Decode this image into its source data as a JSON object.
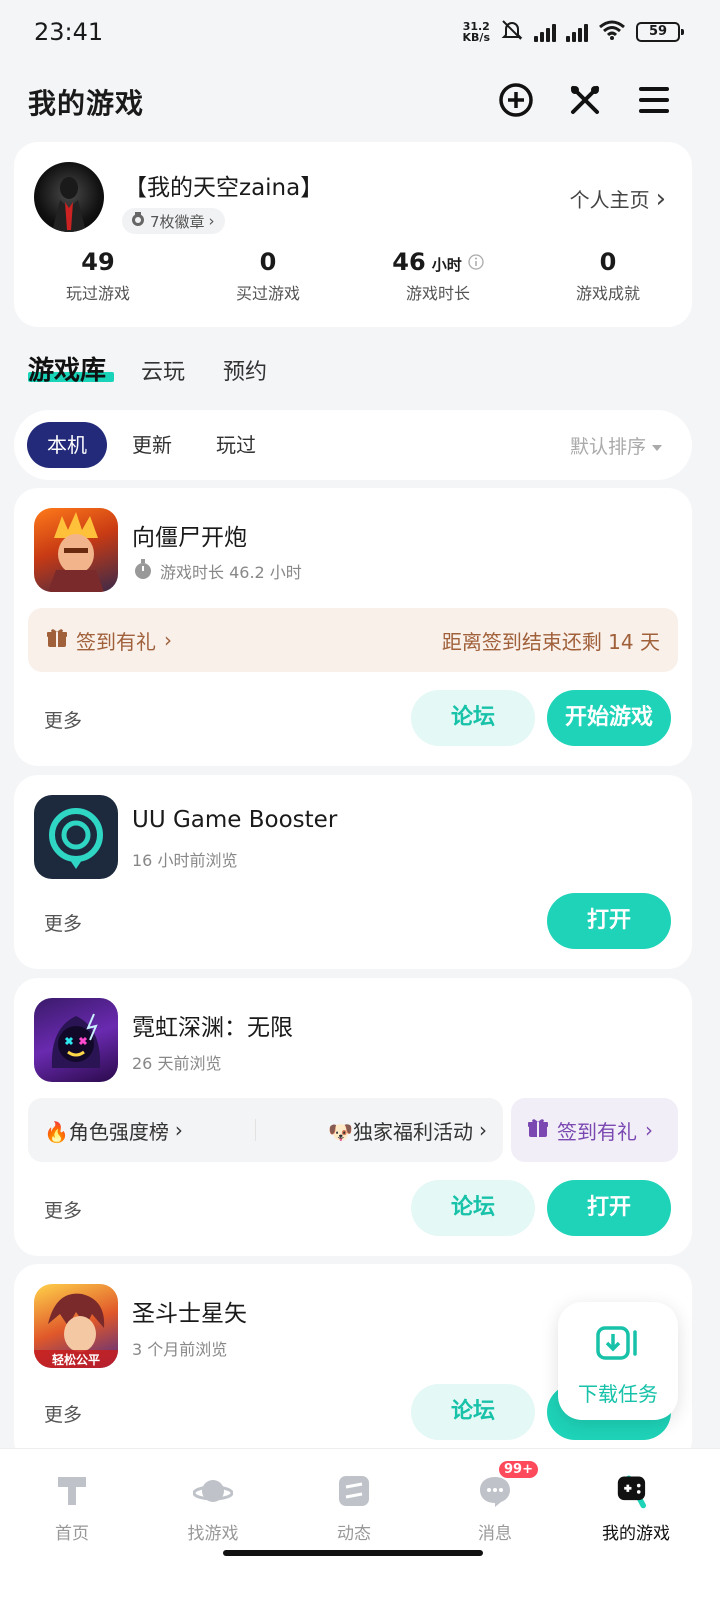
{
  "status_bar": {
    "time": "23:41",
    "net_speed_value": "31.2",
    "net_speed_unit": "KB/s",
    "battery": "59"
  },
  "header": {
    "title": "我的游戏",
    "icons": [
      "add-circle-icon",
      "tools-icon",
      "menu-icon"
    ]
  },
  "profile": {
    "username": "【我的天空zaina】",
    "badge_label": "7枚徽章",
    "profile_link": "个人主页",
    "stats": [
      {
        "value": "49",
        "unit": "",
        "label": "玩过游戏"
      },
      {
        "value": "0",
        "unit": "",
        "label": "买过游戏"
      },
      {
        "value": "46",
        "unit": "小时",
        "label": "游戏时长"
      },
      {
        "value": "0",
        "unit": "",
        "label": "游戏成就"
      }
    ]
  },
  "tabs": [
    {
      "label": "游戏库",
      "active": true
    },
    {
      "label": "云玩",
      "active": false
    },
    {
      "label": "预约",
      "active": false
    }
  ],
  "filters": {
    "pills": [
      {
        "label": "本机",
        "active": true
      },
      {
        "label": "更新",
        "active": false
      },
      {
        "label": "玩过",
        "active": false
      }
    ],
    "sort_label": "默认排序"
  },
  "games": [
    {
      "name": "向僵尸开炮",
      "subtitle": "游戏时长 46.2 小时",
      "promo_left": "签到有礼",
      "promo_right": "距离签到结束还剩 14 天",
      "more": "更多",
      "forum": "论坛",
      "action": "开始游戏"
    },
    {
      "name": "UU Game Booster",
      "subtitle": "16 小时前浏览",
      "more": "更多",
      "action": "打开"
    },
    {
      "name": "霓虹深渊：无限",
      "subtitle": "26 天前浏览",
      "links": [
        "🔥角色强度榜",
        "🐶独家福利活动"
      ],
      "sign_in": "签到有礼",
      "more": "更多",
      "forum": "论坛",
      "action": "打开"
    },
    {
      "name": "圣斗士星矢",
      "subtitle": "3 个月前浏览",
      "icon_text": "轻松公平",
      "more": "更多",
      "forum": "论坛"
    }
  ],
  "download_float": {
    "label": "下载任务"
  },
  "bottom_nav": [
    {
      "label": "首页",
      "active": false
    },
    {
      "label": "找游戏",
      "active": false
    },
    {
      "label": "动态",
      "active": false
    },
    {
      "label": "消息",
      "active": false,
      "badge": "99+"
    },
    {
      "label": "我的游戏",
      "active": true
    }
  ],
  "colors": {
    "accent": "#1ed3b8",
    "active_pill": "#232a7a",
    "promo_bg": "#f9f0ea",
    "promo_text": "#a0603a",
    "purple": "#7a48b0"
  }
}
